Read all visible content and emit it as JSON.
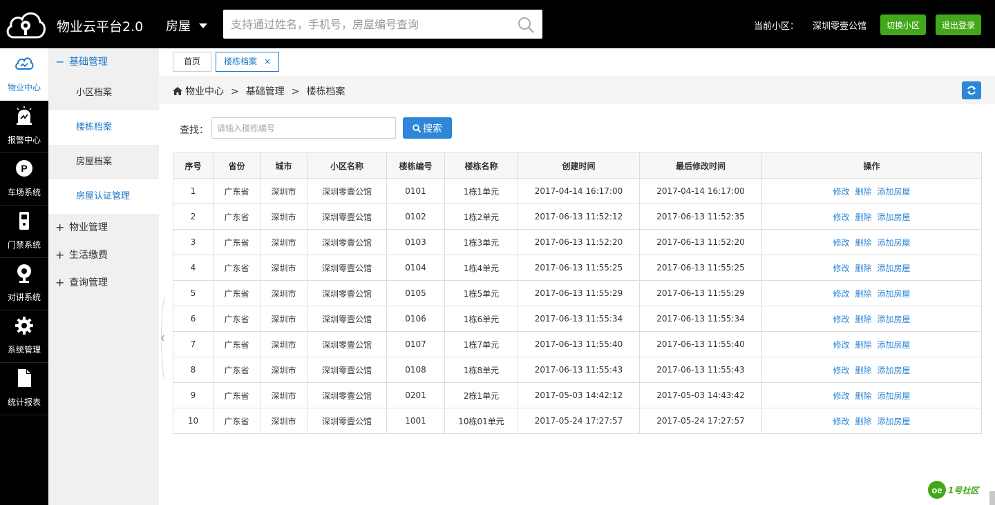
{
  "header": {
    "app_title": "物业云平台2.0",
    "module": "房屋",
    "search_placeholder": "支持通过姓名，手机号，房屋编号查询",
    "current_label": "当前小区：",
    "current_name": "深圳零壹公馆",
    "switch_label": "切换小区",
    "logout_label": "退出登录"
  },
  "iconbar": [
    {
      "label": "物业中心",
      "icon": "cloud-icon",
      "active": true
    },
    {
      "label": "报警中心",
      "icon": "alarm-icon",
      "active": false
    },
    {
      "label": "车场系统",
      "icon": "parking-icon",
      "active": false
    },
    {
      "label": "门禁系统",
      "icon": "door-access-icon",
      "active": false
    },
    {
      "label": "对讲系统",
      "icon": "intercom-icon",
      "active": false
    },
    {
      "label": "系统管理",
      "icon": "gear-icon",
      "active": false
    },
    {
      "label": "统计报表",
      "icon": "document-icon",
      "active": false
    }
  ],
  "subnav": {
    "basic_group": {
      "sign": "−",
      "label": "基础管理"
    },
    "basic_items": [
      {
        "label": "小区档案",
        "active": false
      },
      {
        "label": "楼栋档案",
        "active": true
      },
      {
        "label": "房屋档案",
        "active": false
      },
      {
        "label": "房屋认证管理",
        "active": false
      }
    ],
    "other_groups": [
      {
        "sign": "+",
        "label": "物业管理"
      },
      {
        "sign": "+",
        "label": "生活缴费"
      },
      {
        "sign": "+",
        "label": "查询管理"
      }
    ]
  },
  "tabs": {
    "home": "首页",
    "building": "楼栋档案",
    "close": "×"
  },
  "breadcrumb": {
    "part1": "物业中心",
    "sep": ">",
    "part2": "基础管理",
    "part3": "楼栋档案"
  },
  "search": {
    "label": "查找：",
    "placeholder": "请输入楼栋编号",
    "button": "搜索"
  },
  "table": {
    "headers": [
      "序号",
      "省份",
      "城市",
      "小区名称",
      "楼栋编号",
      "楼栋名称",
      "创建时间",
      "最后修改时间",
      "操作"
    ],
    "actions": [
      "修改",
      "删除",
      "添加房屋"
    ],
    "rows": [
      [
        "1",
        "广东省",
        "深圳市",
        "深圳零壹公馆",
        "0101",
        "1栋1单元",
        "2017-04-14 16:17:00",
        "2017-04-14 16:17:00"
      ],
      [
        "2",
        "广东省",
        "深圳市",
        "深圳零壹公馆",
        "0102",
        "1栋2单元",
        "2017-06-13 11:52:12",
        "2017-06-13 11:52:35"
      ],
      [
        "3",
        "广东省",
        "深圳市",
        "深圳零壹公馆",
        "0103",
        "1栋3单元",
        "2017-06-13 11:52:20",
        "2017-06-13 11:52:20"
      ],
      [
        "4",
        "广东省",
        "深圳市",
        "深圳零壹公馆",
        "0104",
        "1栋4单元",
        "2017-06-13 11:55:25",
        "2017-06-13 11:55:25"
      ],
      [
        "5",
        "广东省",
        "深圳市",
        "深圳零壹公馆",
        "0105",
        "1栋5单元",
        "2017-06-13 11:55:29",
        "2017-06-13 11:55:29"
      ],
      [
        "6",
        "广东省",
        "深圳市",
        "深圳零壹公馆",
        "0106",
        "1栋6单元",
        "2017-06-13 11:55:34",
        "2017-06-13 11:55:34"
      ],
      [
        "7",
        "广东省",
        "深圳市",
        "深圳零壹公馆",
        "0107",
        "1栋7单元",
        "2017-06-13 11:55:40",
        "2017-06-13 11:55:40"
      ],
      [
        "8",
        "广东省",
        "深圳市",
        "深圳零壹公馆",
        "0108",
        "1栋8单元",
        "2017-06-13 11:55:43",
        "2017-06-13 11:55:43"
      ],
      [
        "9",
        "广东省",
        "深圳市",
        "深圳零壹公馆",
        "0201",
        "2栋1单元",
        "2017-05-03 14:42:12",
        "2017-05-03 14:43:42"
      ],
      [
        "10",
        "广东省",
        "深圳市",
        "深圳零壹公馆",
        "1001",
        "10栋01单元",
        "2017-05-24 17:27:57",
        "2017-05-24 17:27:57"
      ]
    ]
  },
  "brand": {
    "text": "1号社区"
  },
  "colors": {
    "accent": "#2d86d7",
    "green": "#43a71a",
    "topbar": "#000000"
  }
}
